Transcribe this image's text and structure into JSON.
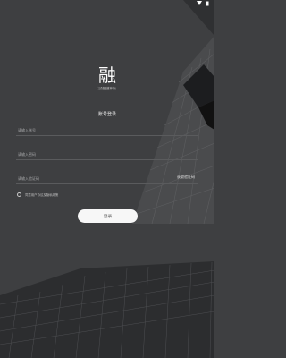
{
  "status": {
    "icons": [
      "wifi-icon",
      "battery-icon"
    ]
  },
  "brand": {
    "logo_glyph": "融",
    "subtitle": "江西省融媒体中心"
  },
  "login": {
    "title": "账号登录",
    "phone_placeholder": "请输入账号",
    "password_placeholder": "请输入密码",
    "code_placeholder": "请输入验证码",
    "get_code_label": "获取验证码",
    "agreement_text": "同意用户协议及隐私政策",
    "submit_label": "登录"
  },
  "colors": {
    "background": "#3e3f41",
    "button": "#f7f7f7"
  }
}
